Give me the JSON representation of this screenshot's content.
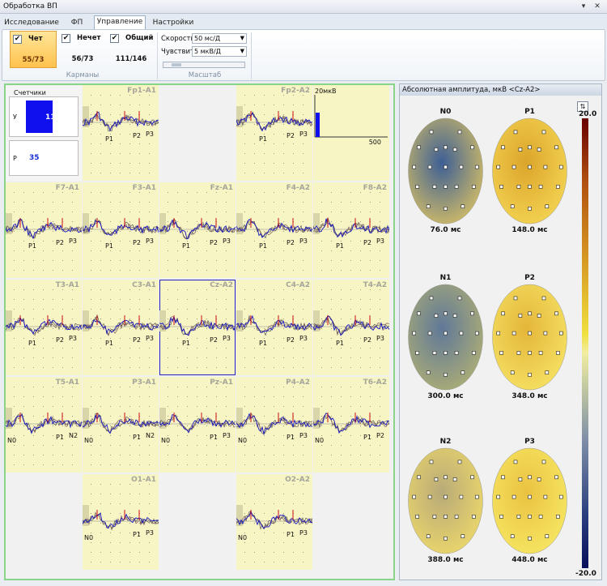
{
  "window": {
    "title": "Обработка ВП",
    "buttons": [
      "▾",
      "✕"
    ]
  },
  "tabs": [
    {
      "label": "Исследование",
      "active": false
    },
    {
      "label": "ФП",
      "active": false
    },
    {
      "label": "Управление",
      "active": true
    },
    {
      "label": "Настройки",
      "active": false
    }
  ],
  "ribbon": {
    "pockets": [
      {
        "label": "Чет",
        "value": "55/73",
        "checked": true,
        "selected": true
      },
      {
        "label": "Нечет",
        "value": "56/73",
        "checked": true,
        "selected": false
      },
      {
        "label": "Общий",
        "value": "111/146",
        "checked": true,
        "selected": false
      }
    ],
    "pockets_group": "Карманы",
    "speed_label": "Скорость",
    "speed_value": "50 мс/Д",
    "sens_label": "Чувствит.",
    "sens_value": "5 мкВ/Д",
    "scale_group": "Масштаб"
  },
  "counters": {
    "title": "Счетчики",
    "rows": [
      {
        "key": "У",
        "value": "111",
        "fill": 0.45
      },
      {
        "key": "Р",
        "value": "35",
        "fill": 0
      }
    ]
  },
  "scale_cell": {
    "amp_label": "20мкВ",
    "time_label": "500"
  },
  "channels": [
    {
      "name": "Fp1-A1",
      "col": 1,
      "row": 0,
      "peaks": [
        "P1",
        "P2",
        "P3"
      ]
    },
    {
      "name": "Fp2-A2",
      "col": 3,
      "row": 0,
      "peaks": [
        "P1",
        "P2",
        "P3"
      ]
    },
    {
      "name": "F7-A1",
      "col": 0,
      "row": 1,
      "peaks": [
        "P1",
        "P2",
        "P3"
      ]
    },
    {
      "name": "F3-A1",
      "col": 1,
      "row": 1,
      "peaks": [
        "P1",
        "P2",
        "P3"
      ]
    },
    {
      "name": "Fz-A1",
      "col": 2,
      "row": 1,
      "peaks": [
        "P1",
        "P2",
        "P3"
      ]
    },
    {
      "name": "F4-A2",
      "col": 3,
      "row": 1,
      "peaks": [
        "P1",
        "P2",
        "P3"
      ]
    },
    {
      "name": "F8-A2",
      "col": 4,
      "row": 1,
      "peaks": [
        "P1",
        "P2",
        "P3"
      ]
    },
    {
      "name": "T3-A1",
      "col": 0,
      "row": 2,
      "peaks": [
        "P1",
        "P2",
        "P3"
      ]
    },
    {
      "name": "C3-A1",
      "col": 1,
      "row": 2,
      "peaks": [
        "P1",
        "P2",
        "P3"
      ]
    },
    {
      "name": "Cz-A2",
      "col": 2,
      "row": 2,
      "peaks": [
        "P1",
        "P2",
        "P3"
      ],
      "selected": true
    },
    {
      "name": "C4-A2",
      "col": 3,
      "row": 2,
      "peaks": [
        "P1",
        "P2",
        "P3"
      ]
    },
    {
      "name": "T4-A2",
      "col": 4,
      "row": 2,
      "peaks": [
        "P1",
        "P2",
        "P3"
      ]
    },
    {
      "name": "T5-A1",
      "col": 0,
      "row": 3,
      "peaks": [
        "N0",
        "P1",
        "N2"
      ]
    },
    {
      "name": "P3-A1",
      "col": 1,
      "row": 3,
      "peaks": [
        "N0",
        "P1",
        "N2"
      ]
    },
    {
      "name": "Pz-A1",
      "col": 2,
      "row": 3,
      "peaks": [
        "N0",
        "P1",
        "P3"
      ]
    },
    {
      "name": "P4-A2",
      "col": 3,
      "row": 3,
      "peaks": [
        "N0",
        "P1",
        "P3"
      ]
    },
    {
      "name": "T6-A2",
      "col": 4,
      "row": 3,
      "peaks": [
        "N0",
        "P1",
        "P2"
      ]
    },
    {
      "name": "O1-A1",
      "col": 1,
      "row": 4,
      "peaks": [
        "N0",
        "P1",
        "P3"
      ]
    },
    {
      "name": "O2-A2",
      "col": 3,
      "row": 4,
      "peaks": [
        "N0",
        "P1",
        "P3"
      ]
    }
  ],
  "panel": {
    "title": "Абсолютная амплитуда, мкВ <Cz-A2>",
    "scale_max": "20.0",
    "scale_min": "-20.0",
    "maps": [
      {
        "name": "N0",
        "time": "76.0 мс",
        "c1": "#c8b66a",
        "c2": "#3d5f95"
      },
      {
        "name": "P1",
        "time": "148.0 мс",
        "c1": "#f2d050",
        "c2": "#dba52b"
      },
      {
        "name": "N1",
        "time": "300.0 мс",
        "c1": "#a8aa78",
        "c2": "#5f7898"
      },
      {
        "name": "P2",
        "time": "348.0 мс",
        "c1": "#f4de60",
        "c2": "#e4b63a"
      },
      {
        "name": "N2",
        "time": "388.0 мс",
        "c1": "#e8d46c",
        "c2": "#b8aa78"
      },
      {
        "name": "P3",
        "time": "448.0 мс",
        "c1": "#f5e460",
        "c2": "#ebc242"
      }
    ]
  }
}
